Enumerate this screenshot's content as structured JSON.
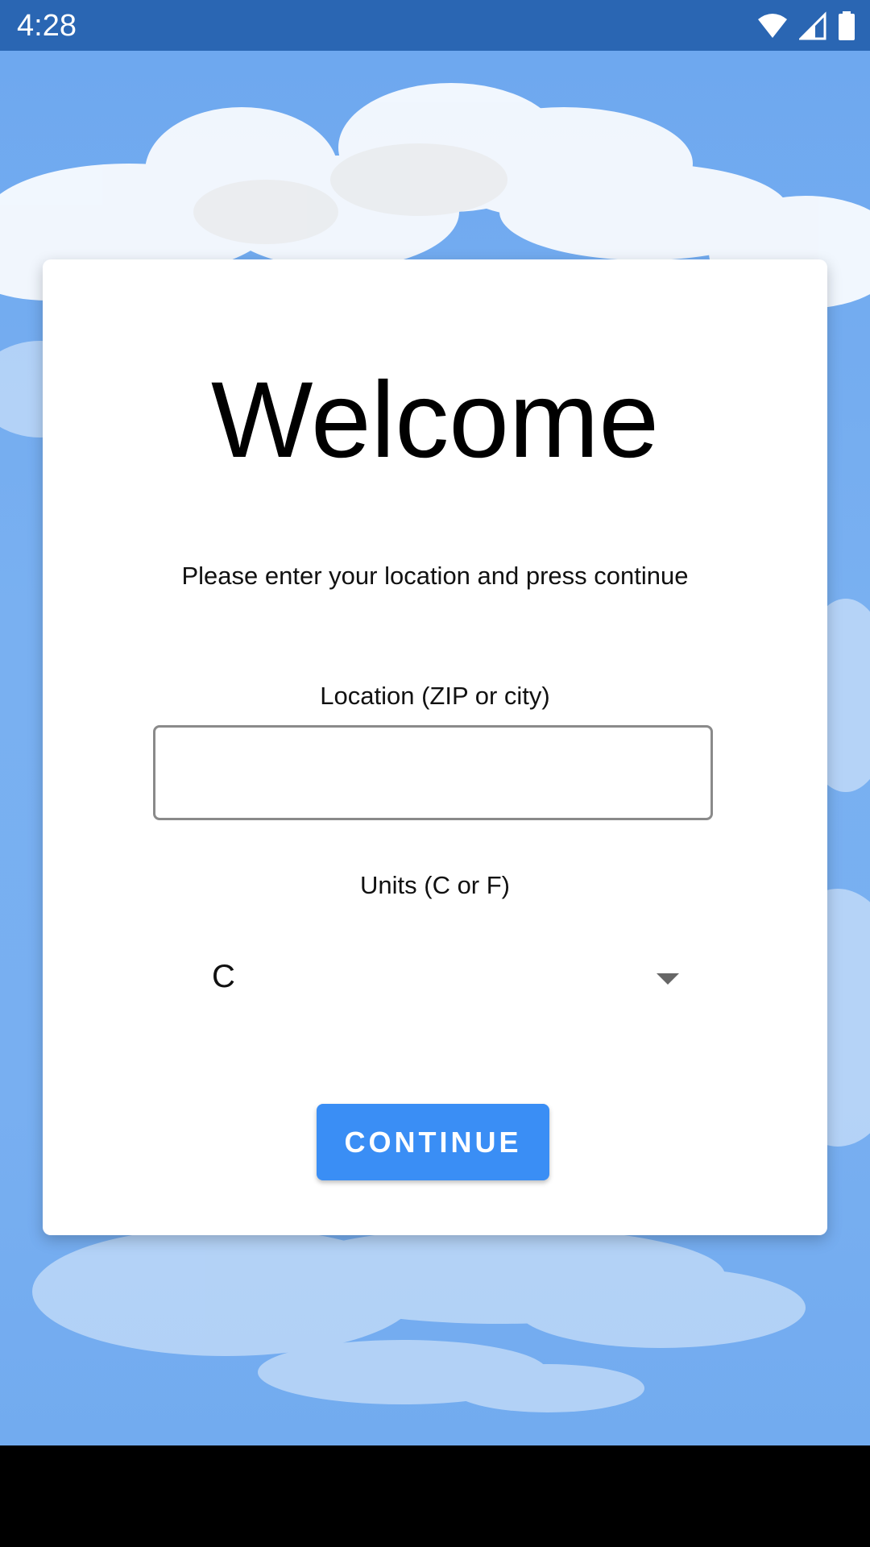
{
  "status_bar": {
    "time": "4:28",
    "icons": [
      "wifi-icon",
      "signal-icon",
      "battery-icon"
    ]
  },
  "card": {
    "title": "Welcome",
    "instructions": "Please enter your location and press continue",
    "location_label": "Location (ZIP or city)",
    "location_value": "",
    "units_label": "Units (C or F)",
    "units_selected": "C",
    "continue_label": "CONTINUE"
  },
  "colors": {
    "status_bar": "#2a66b3",
    "sky": "#78aff1",
    "button": "#3a8ef5",
    "card": "#ffffff"
  }
}
